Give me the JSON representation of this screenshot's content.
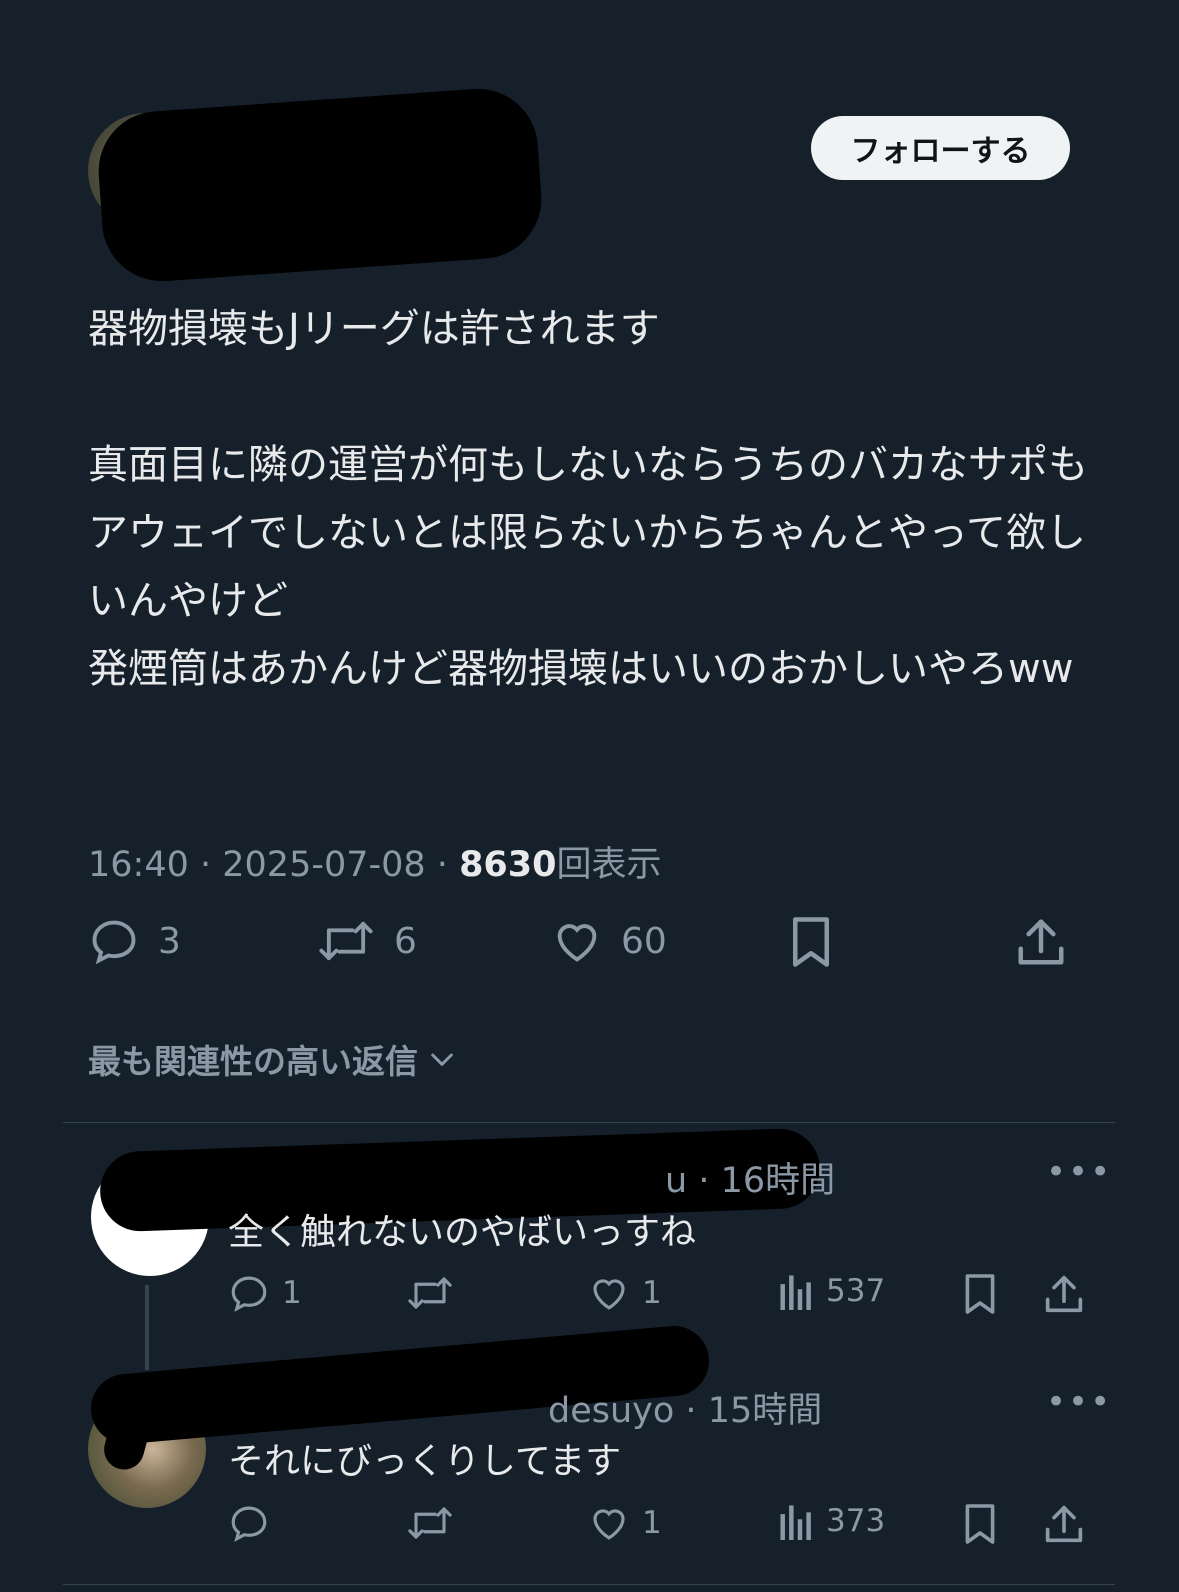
{
  "header": {
    "follow_label": "フォローする"
  },
  "tweet": {
    "text": "器物損壊もJリーグは許されます\n\n真面目に隣の運営が何もしないならうちのバカなサポもアウェイでしないとは限らないからちゃんとやって欲しいんやけど\n発煙筒はあかんけど器物損壊はいいのおかしいやろww",
    "time": "16:40",
    "date": "2025-07-08",
    "views": "8630",
    "views_label": "回表示",
    "replies": "3",
    "retweets": "6",
    "likes": "60"
  },
  "sort": {
    "label": "最も関連性の高い返信"
  },
  "replies": [
    {
      "handle_tail": "u",
      "age": "16時間",
      "text": "全く触れないのやばいっすね",
      "replies": "1",
      "retweets": "",
      "likes": "1",
      "views": "537"
    },
    {
      "handle_tail": "desuyo",
      "age": "15時間",
      "text": "それにびっくりしてます",
      "replies": "",
      "retweets": "",
      "likes": "1",
      "views": "373"
    }
  ],
  "colors": {
    "background": "#15202b",
    "text": "#e7e9ea",
    "muted": "#8b98a5",
    "divider": "#38444d"
  }
}
